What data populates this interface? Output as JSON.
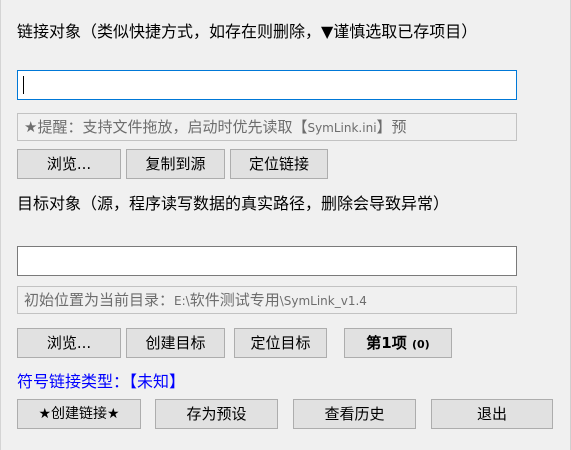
{
  "source": {
    "label": "链接对象（类似快捷方式，如存在则删除，▼谨慎选取已存项目）",
    "input_value": "",
    "hint_main": "★提醒：支持文件拖放，启动时优先读取【",
    "hint_file": "SymLink.ini",
    "hint_end": "】预",
    "browse_button": "浏览...",
    "copy_to_source_button": "复制到源",
    "locate_link_button": "定位链接"
  },
  "target": {
    "label": "目标对象（源，程序读写数据的真实路径，删除会导致异常）",
    "input_value": "",
    "hint_main": "初始位置为当前目录：",
    "hint_path_a": "E:\\",
    "hint_path_b": "软件测试专用",
    "hint_path_c": "\\SymLink_v1.4",
    "browse_button": "浏览...",
    "create_target_button": "创建目标",
    "locate_target_button": "定位目标",
    "item_button_main": "第1项",
    "item_button_count": "(0)"
  },
  "link_type": {
    "label": "符号链接类型：",
    "value": "【未知】",
    "color": "#0000ff"
  },
  "actions": {
    "create_link_button": "★创建链接★",
    "save_preset_button": "存为预设",
    "view_history_button": "查看历史",
    "exit_button": "退出"
  }
}
